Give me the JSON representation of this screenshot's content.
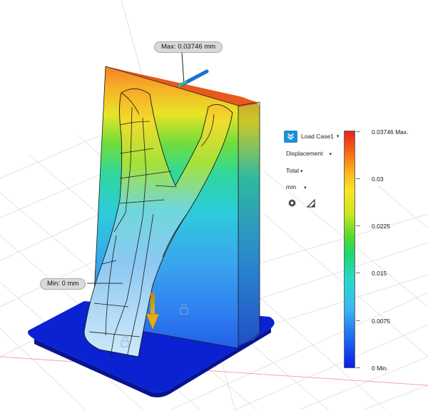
{
  "probes": {
    "max_label": "Max: 0.03746 mm",
    "min_label": "Min: 0 mm"
  },
  "controls": {
    "load_case": "Load Case1",
    "result_type": "Displacement",
    "component": "Total",
    "units": "mm"
  },
  "icons": {
    "load_case_button": "double-chevron-down-icon",
    "settings": "gear-icon",
    "adjust": "triangle-adjust-icon",
    "load_arrow": "force-arrow-icon"
  },
  "legend": {
    "labels": [
      "0.03746 Max.",
      "0.03",
      "0.0225",
      "0.015",
      "0.0075",
      "0 Min."
    ],
    "values": [
      0.03746,
      0.03,
      0.0225,
      0.015,
      0.0075,
      0
    ],
    "max": 0.03746,
    "min": 0,
    "colors": {
      "max": "#e8211e",
      "mid_high": "#fbe51f",
      "mid": "#1ed86d",
      "mid_low": "#39b8f0",
      "min": "#0a1ee8"
    }
  },
  "colors": {
    "accent": "#1f8fd6",
    "fixture_base": "#0a22d2",
    "load_arrow": "#c99a12"
  }
}
